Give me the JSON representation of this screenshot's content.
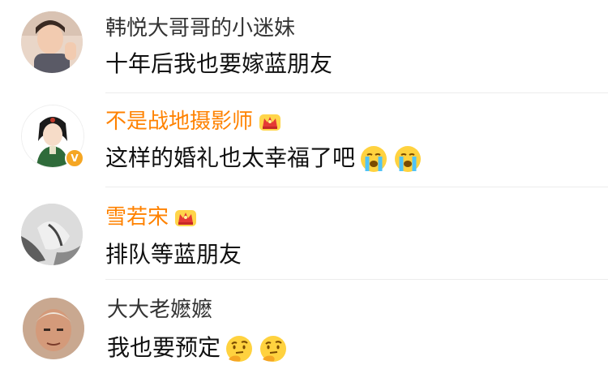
{
  "comments": [
    {
      "username": "韩悦大哥哥的小迷妹",
      "text": "十年后我也要嫁蓝朋友",
      "vip": false,
      "emojis": []
    },
    {
      "username": "不是战地摄影师",
      "text": "这样的婚礼也太幸福了吧",
      "vip": true,
      "verified_badge": "V",
      "emojis": [
        "crying-face-icon",
        "crying-face-icon"
      ]
    },
    {
      "username": "雪若宋",
      "text": "排队等蓝朋友",
      "vip": true,
      "emojis": []
    },
    {
      "username": "大大老嬷嬷",
      "text": "我也要预定",
      "vip": false,
      "emojis": [
        "thinking-face-icon",
        "thinking-face-icon"
      ]
    }
  ],
  "colors": {
    "vip_name": "#ff8200",
    "normal_name": "#333333",
    "text": "#111111",
    "divider": "#ececec",
    "badge": "#f5a623"
  }
}
